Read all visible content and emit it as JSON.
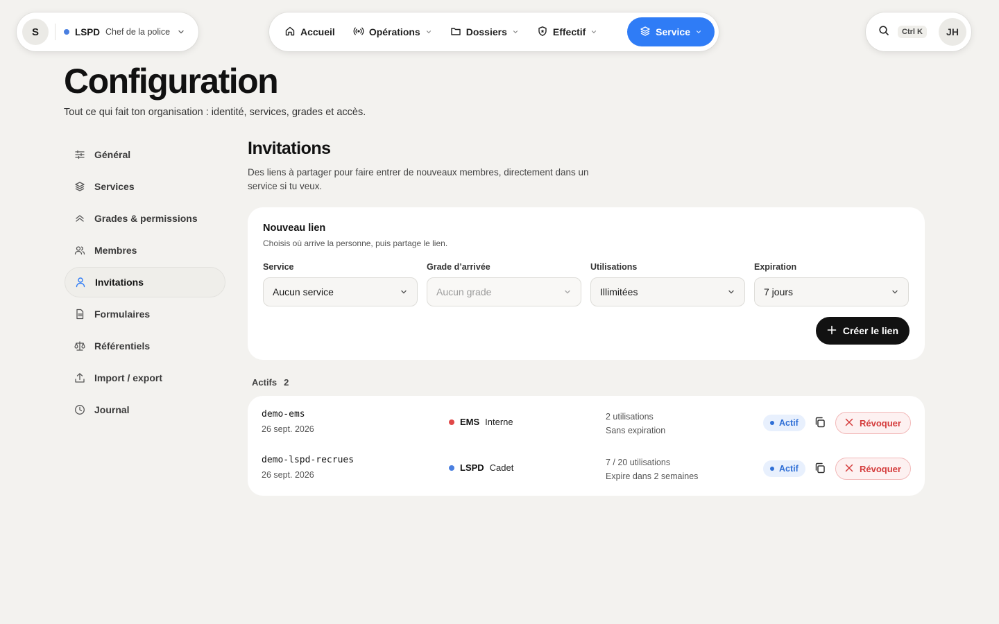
{
  "org": {
    "avatar": "S",
    "name": "LSPD",
    "role": "Chef de la police",
    "dot_color": "#4a7fe0"
  },
  "nav": {
    "items": [
      {
        "label": "Accueil",
        "icon": "home-icon"
      },
      {
        "label": "Opérations",
        "icon": "broadcast-icon"
      },
      {
        "label": "Dossiers",
        "icon": "folder-icon"
      },
      {
        "label": "Effectif",
        "icon": "badge-icon"
      },
      {
        "label": "Service",
        "icon": "layers-icon",
        "active": true
      }
    ]
  },
  "top_right": {
    "shortcut": "Ctrl K",
    "user_initials": "JH"
  },
  "page": {
    "title": "Configuration",
    "subtitle": "Tout ce qui fait ton organisation : identité, services, grades et accès."
  },
  "sidebar": {
    "items": [
      {
        "label": "Général",
        "icon": "sliders-icon"
      },
      {
        "label": "Services",
        "icon": "layers-icon"
      },
      {
        "label": "Grades & permissions",
        "icon": "chevrons-up-icon"
      },
      {
        "label": "Membres",
        "icon": "users-icon"
      },
      {
        "label": "Invitations",
        "icon": "user-icon",
        "active": true
      },
      {
        "label": "Formulaires",
        "icon": "file-icon"
      },
      {
        "label": "Référentiels",
        "icon": "scale-icon"
      },
      {
        "label": "Import / export",
        "icon": "upload-icon"
      },
      {
        "label": "Journal",
        "icon": "clock-icon"
      }
    ]
  },
  "invitations": {
    "title": "Invitations",
    "description": "Des liens à partager pour faire entrer de nouveaux membres, directement dans un service si tu veux.",
    "new_link": {
      "title": "Nouveau lien",
      "description": "Choisis où arrive la personne, puis partage le lien.",
      "fields": [
        {
          "label": "Service",
          "value": "Aucun service",
          "disabled": false
        },
        {
          "label": "Grade d’arrivée",
          "value": "Aucun grade",
          "disabled": true
        },
        {
          "label": "Utilisations",
          "value": "Illimitées",
          "disabled": false
        },
        {
          "label": "Expiration",
          "value": "7 jours",
          "disabled": false
        }
      ],
      "create_label": "Créer le lien"
    },
    "active_label": "Actifs",
    "active_count": "2",
    "links": [
      {
        "slug": "demo-ems",
        "date": "26 sept. 2026",
        "service_code": "EMS",
        "service_color": "#e04848",
        "grade": "Interne",
        "uses": "2 utilisations",
        "expiry": "Sans expiration",
        "status": "Actif",
        "revoke_label": "Révoquer"
      },
      {
        "slug": "demo-lspd-recrues",
        "date": "26 sept. 2026",
        "service_code": "LSPD",
        "service_color": "#4a7fe0",
        "grade": "Cadet",
        "uses": "7 / 20 utilisations",
        "expiry": "Expire dans 2 semaines",
        "status": "Actif",
        "revoke_label": "Révoquer"
      }
    ]
  }
}
